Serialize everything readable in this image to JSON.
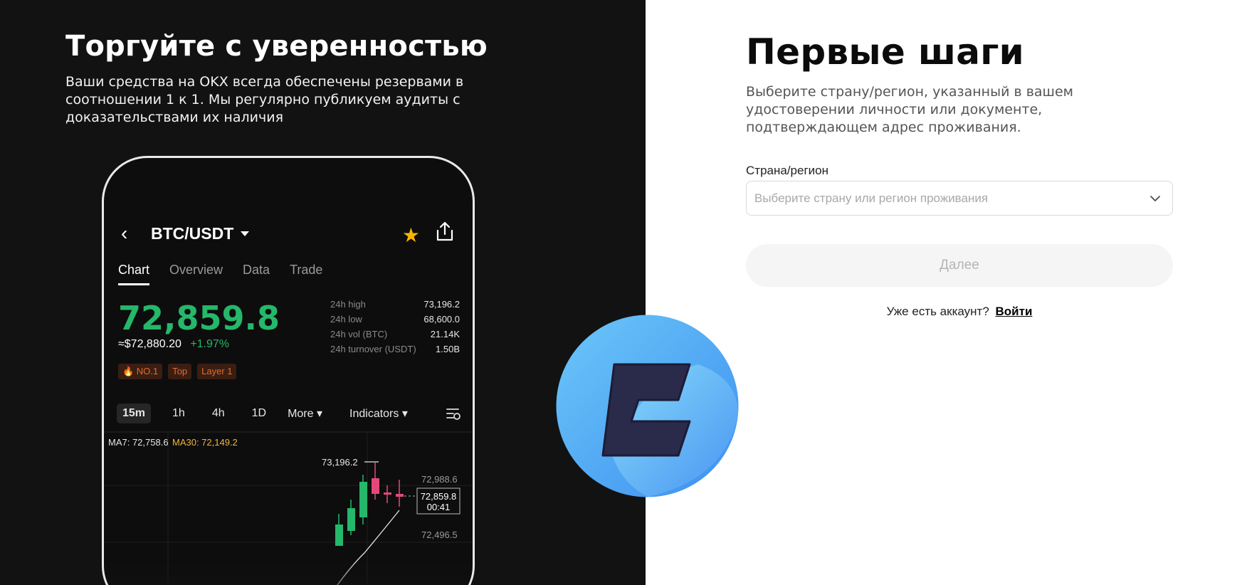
{
  "promo": {
    "headline": "Торгуйте с уверенностью",
    "description": "Ваши средства на OKX всегда обеспечены резервами в соотношении 1 к 1. Мы регулярно публикуем аудиты с доказательствами их наличия"
  },
  "phone": {
    "back_icon": "chevron-left-icon",
    "pair": "BTC/USDT",
    "star_icon": "star-icon",
    "share_icon": "share-icon",
    "tabs": [
      {
        "label": "Chart",
        "active": true
      },
      {
        "label": "Overview",
        "active": false
      },
      {
        "label": "Data",
        "active": false
      },
      {
        "label": "Trade",
        "active": false
      }
    ],
    "price": "72,859.8",
    "usd_price": "≈$72,880.20",
    "change": "+1.97%",
    "tags": [
      "🔥 NO.1",
      "Top",
      "Layer 1"
    ],
    "stats": [
      {
        "label": "24h high",
        "value": "73,196.2"
      },
      {
        "label": "24h low",
        "value": "68,600.0"
      },
      {
        "label": "24h vol (BTC)",
        "value": "21.14K"
      },
      {
        "label": "24h turnover (USDT)",
        "value": "1.50B"
      }
    ],
    "timeframes": [
      "15m",
      "1h",
      "4h",
      "1D"
    ],
    "more_label": "More",
    "indicators_label": "Indicators",
    "ma7": "MA7: 72,758.6",
    "ma30": "MA30: 72,149.2",
    "high_marker": "73,196.2",
    "axis_labels": [
      "72,988.6",
      "72,496.5"
    ],
    "current_price_tag": "72,859.8",
    "countdown": "00:41",
    "colors": {
      "up": "#25b76a",
      "down": "#e4487a",
      "ma30": "#f0b43c"
    }
  },
  "form": {
    "title": "Первые шаги",
    "description": "Выберите страну/регион, указанный в вашем удостоверении личности или документе, подтверждающем адрес проживания.",
    "country_label": "Страна/регион",
    "country_placeholder": "Выберите страну или регион проживания",
    "next_button": "Далее",
    "login_prompt": "Уже есть аккаунт?",
    "login_link": "Войти"
  }
}
